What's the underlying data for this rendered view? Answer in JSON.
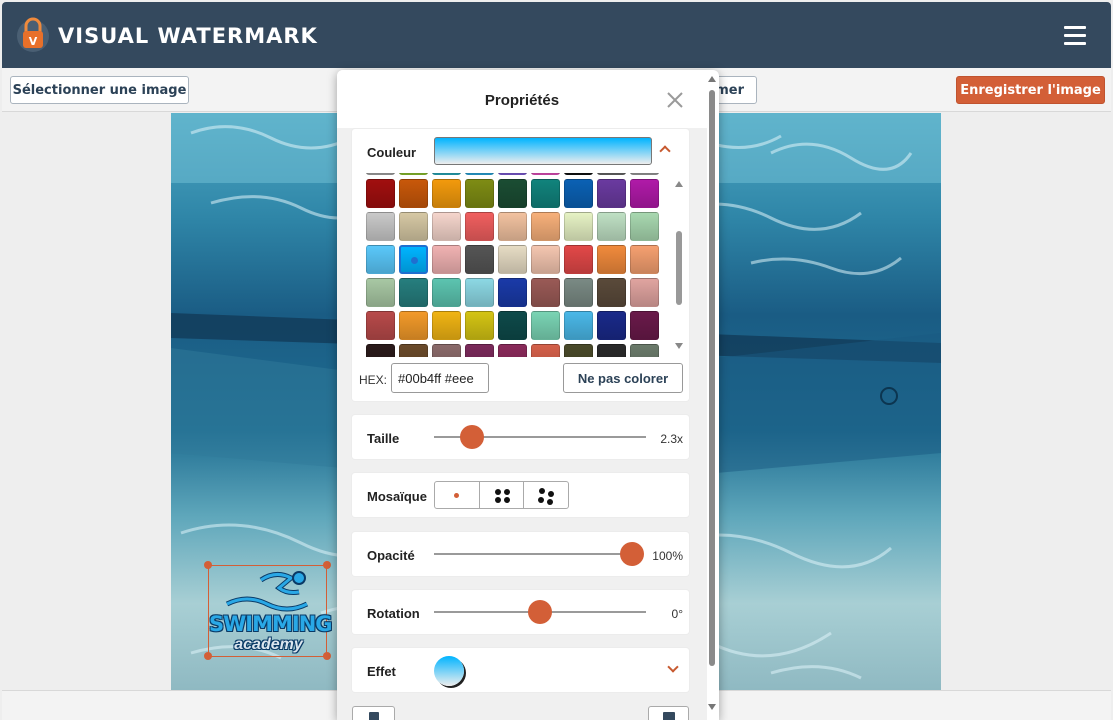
{
  "header": {
    "brand": "VISUAL WATERMARK",
    "logo_icon": "padlock-logo-icon",
    "menu_icon": "hamburger-menu-icon"
  },
  "toolbar": {
    "select_label": "Sélectionner une image",
    "hidden_label": "mer",
    "save_label": "Enregistrer l'image"
  },
  "watermark": {
    "line1": "SWIMMING",
    "line2": "academy"
  },
  "panel": {
    "title": "Propriétés",
    "color": {
      "label": "Couleur",
      "hex_label": "HEX:",
      "hex_value": "#00b4ff #eee",
      "no_color_label": "Ne pas colorer",
      "rows": [
        [
          "#a3a3a3",
          "#8bbf2e",
          "#27a6b6",
          "#2aa4d8",
          "#7c5ad2",
          "#e04fb9",
          "#111111",
          "#666666",
          "#9a9a9a"
        ],
        [
          "#a10f0f",
          "#c8580a",
          "#f29a0c",
          "#7e8c14",
          "#1b4d33",
          "#11837c",
          "#0b61b4",
          "#6a3aa0",
          "#b01aa8"
        ],
        [
          "#c9c9c9",
          "#d6c8a4",
          "#f5d5cc",
          "#f05f5f",
          "#f2c2a0",
          "#f7b07a",
          "#e6f2c4",
          "#bfe0c4",
          "#a8d8b0"
        ],
        [
          "#5ac8fa",
          "#00b4ff",
          "#f0b2b2",
          "#555555",
          "#e6dcc4",
          "#f4c6b0",
          "#e24848",
          "#f08a3c",
          "#f5a070"
        ],
        [
          "#a8c8a4",
          "#267e7e",
          "#5cc4b0",
          "#8cd8e4",
          "#1a3aa8",
          "#9a5a56",
          "#7a8a84",
          "#5a4a3a",
          "#e0a4a0"
        ],
        [
          "#b84a4a",
          "#f29a2a",
          "#f0b414",
          "#d4c414",
          "#0e4a4a",
          "#7ad4b4",
          "#4ab8e8",
          "#1a2a8a",
          "#6a1a4a"
        ],
        [
          "#2a1a1a",
          "#6a4a2a",
          "#8a6a6a",
          "#7a2a5a",
          "#8a2a5a",
          "#d4604a",
          "#4a4a2a",
          "#2a2a2a",
          "#6a7a6a"
        ]
      ],
      "row_tops": [
        -27,
        6,
        39,
        72,
        105,
        138,
        171
      ],
      "selected_row": 3,
      "selected_col": 1
    },
    "size": {
      "label": "Taille",
      "value_text": "2.3x",
      "position_fraction": 0.18
    },
    "mosaic": {
      "label": "Mosaïque",
      "selected_index": 0
    },
    "opacity": {
      "label": "Opacité",
      "value_text": "100%",
      "position_fraction": 1.0
    },
    "rotation": {
      "label": "Rotation",
      "value_text": "0°",
      "position_fraction": 0.5
    },
    "effect": {
      "label": "Effet"
    },
    "accent_color": "#d35f37"
  }
}
